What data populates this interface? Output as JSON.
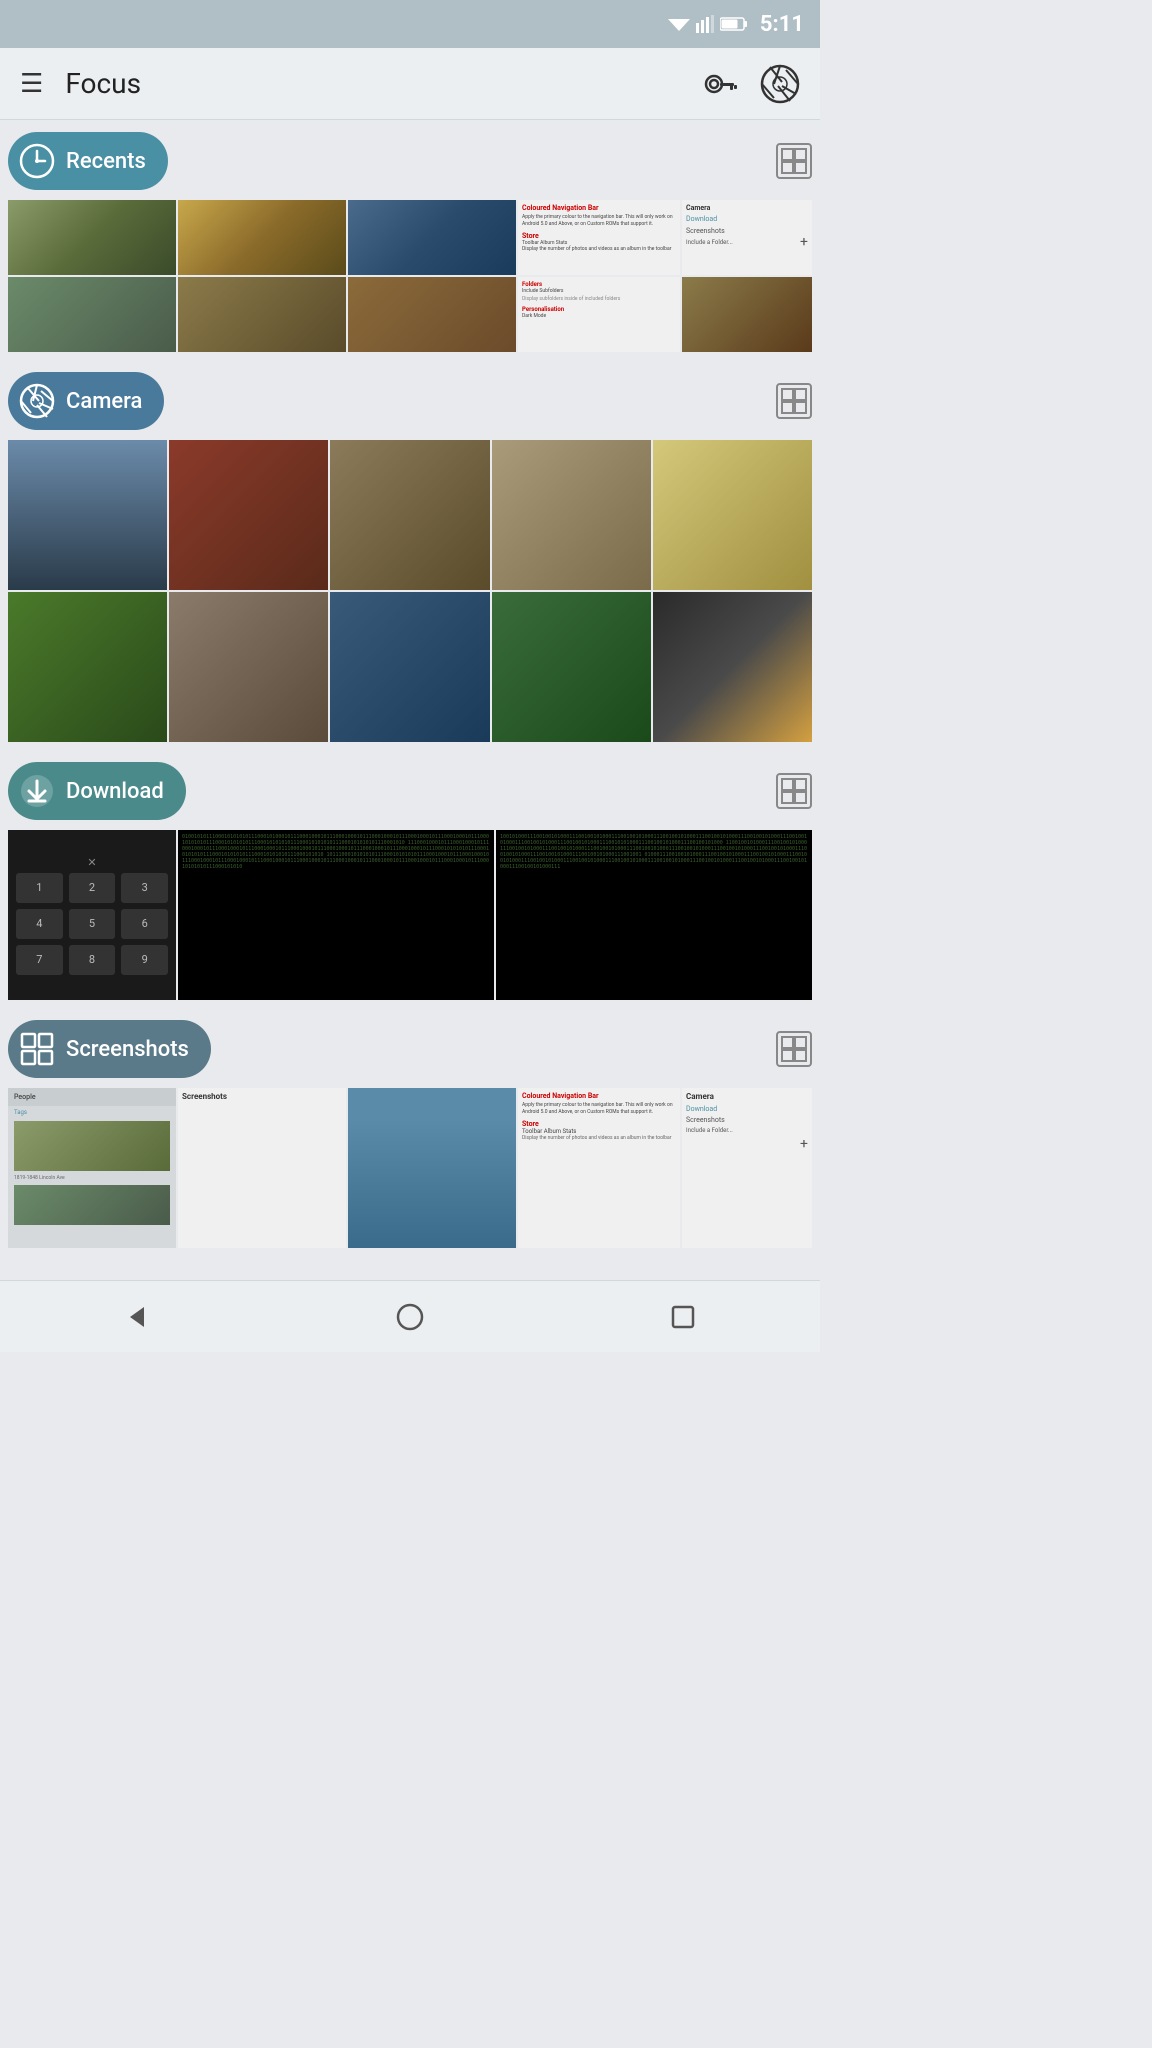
{
  "status_bar": {
    "time": "5:11",
    "battery": "68"
  },
  "top_bar": {
    "menu_icon": "☰",
    "title": "Focus",
    "key_icon": "🔑"
  },
  "sections": [
    {
      "id": "recents",
      "label": "Recents",
      "icon_type": "timer"
    },
    {
      "id": "camera",
      "label": "Camera",
      "icon_type": "aperture"
    },
    {
      "id": "download",
      "label": "Download",
      "icon_type": "download"
    },
    {
      "id": "screenshots",
      "label": "Screenshots",
      "icon_type": "grid"
    }
  ],
  "nav": {
    "back_icon": "◁",
    "home_icon": "○",
    "recent_icon": "□"
  },
  "expand_label": "expand"
}
